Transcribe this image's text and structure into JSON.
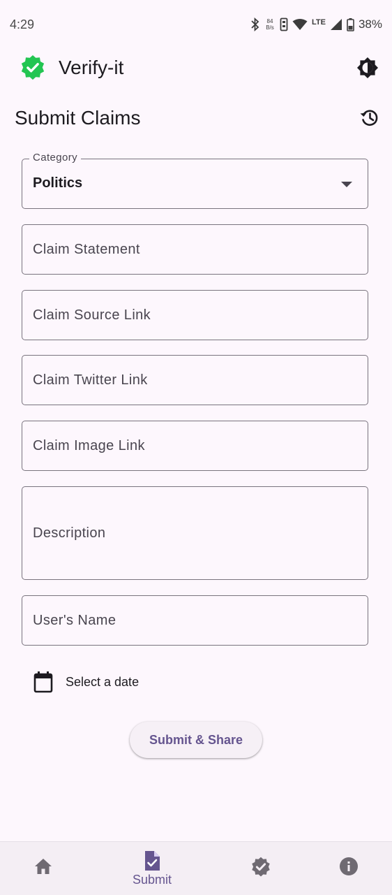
{
  "status_bar": {
    "time": "4:29",
    "net_speed_value": "84",
    "net_speed_unit": "B/s",
    "network_type": "LTE",
    "battery": "38%"
  },
  "app": {
    "title": "Verify-it",
    "accent_color": "#23c552"
  },
  "page": {
    "title": "Submit Claims"
  },
  "form": {
    "category": {
      "label": "Category",
      "value": "Politics"
    },
    "claim_statement": {
      "placeholder": "Claim Statement",
      "value": ""
    },
    "claim_source_link": {
      "placeholder": "Claim Source Link",
      "value": ""
    },
    "claim_twitter_link": {
      "placeholder": "Claim Twitter Link",
      "value": ""
    },
    "claim_image_link": {
      "placeholder": "Claim Image Link",
      "value": ""
    },
    "description": {
      "placeholder": "Description",
      "value": ""
    },
    "user_name": {
      "placeholder": "User's Name",
      "value": ""
    },
    "date": {
      "label": "Select a date"
    },
    "submit_label": "Submit & Share"
  },
  "bottom_nav": {
    "items": [
      {
        "icon": "home-icon",
        "label": ""
      },
      {
        "icon": "submit-document-icon",
        "label": "Submit",
        "selected": true
      },
      {
        "icon": "verified-badge-icon",
        "label": ""
      },
      {
        "icon": "info-icon",
        "label": ""
      }
    ],
    "active_color": "#65558f",
    "inactive_color": "#6f6a72"
  }
}
